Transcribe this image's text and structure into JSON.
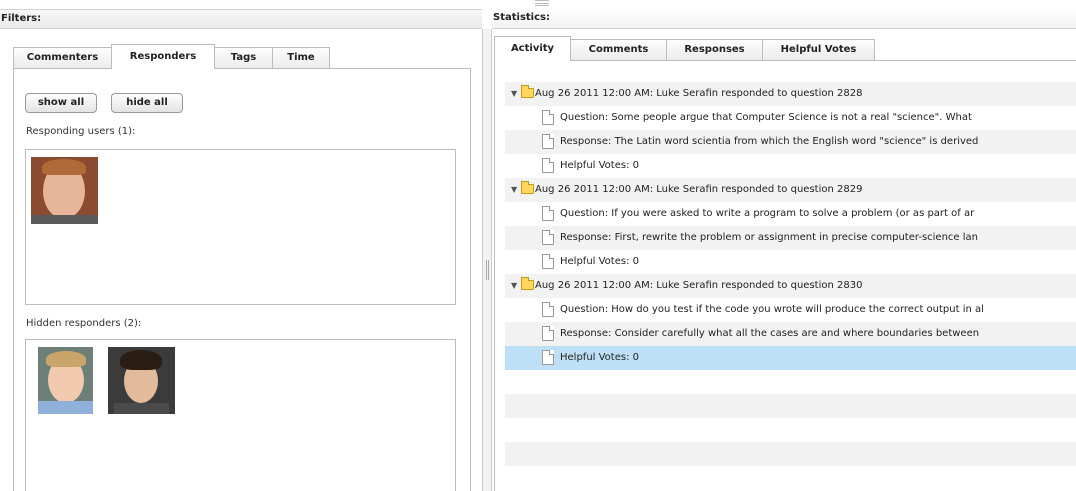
{
  "filters": {
    "title": "Filters:",
    "tabs": [
      "Commenters",
      "Responders",
      "Tags",
      "Time"
    ],
    "active_tab": "Responders",
    "show_all": "show all",
    "hide_all": "hide all",
    "responding_label": "Responding users (1):",
    "hidden_label": "Hidden responders (2):"
  },
  "statistics": {
    "title": "Statistics:",
    "tabs": [
      "Activity",
      "Comments",
      "Responses",
      "Helpful Votes"
    ],
    "active_tab": "Activity",
    "tree": [
      {
        "label": "Aug 26 2011 12:00 AM: Luke Serafin responded to question 2828",
        "children": [
          "Question: Some people argue that Computer Science is not a real \"science\". What",
          "Response: The Latin word scientia from which the English word \"science\" is derived",
          "Helpful Votes: 0"
        ]
      },
      {
        "label": "Aug 26 2011 12:00 AM: Luke Serafin responded to question 2829",
        "children": [
          "Question: If you were asked to write a program to solve a problem (or as part of ar",
          "Response: First, rewrite the problem or assignment in precise computer-science lan",
          "Helpful Votes: 0"
        ]
      },
      {
        "label": "Aug 26 2011 12:00 AM: Luke Serafin responded to question 2830",
        "children": [
          "Question: How do you test if the code you wrote will produce the correct output in al",
          "Response: Consider carefully what all the cases are and where boundaries between",
          "Helpful Votes: 0"
        ]
      }
    ]
  },
  "colors": {
    "selection": "#bde0f6",
    "stripe": "#f2f2f2",
    "folder": "#ffd75a"
  }
}
